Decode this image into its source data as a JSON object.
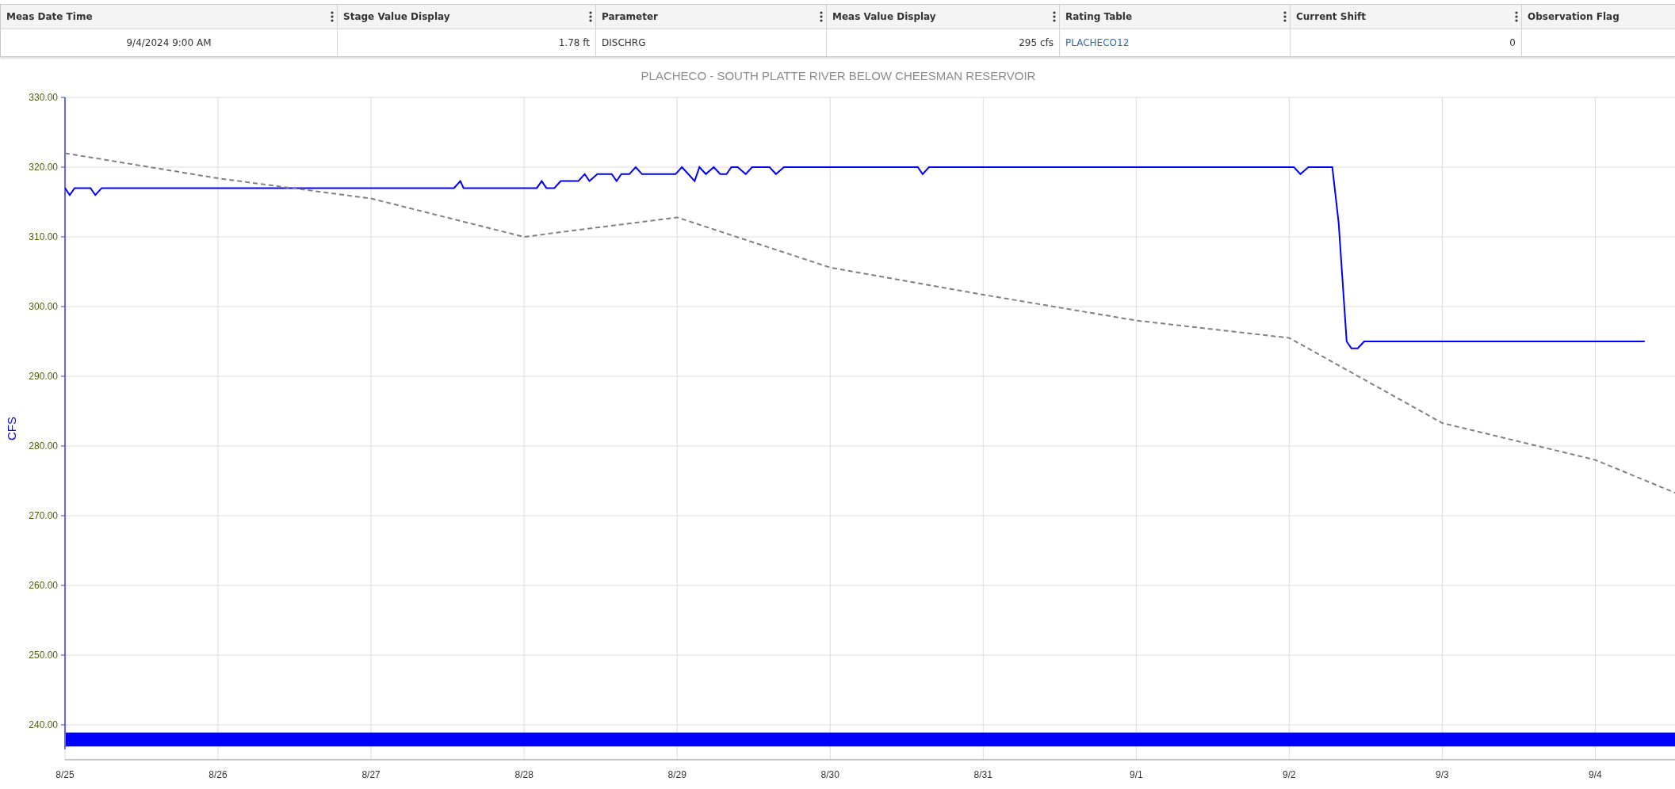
{
  "table": {
    "columns": [
      {
        "label": "Meas Date Time",
        "menu_icon": true
      },
      {
        "label": "Stage Value Display",
        "menu_icon": true
      },
      {
        "label": "Parameter",
        "menu_icon": true
      },
      {
        "label": "Meas Value Display",
        "menu_icon": true
      },
      {
        "label": "Rating Table",
        "menu_icon": true
      },
      {
        "label": "Current Shift",
        "menu_icon": true
      },
      {
        "label": "Observation Flag",
        "menu_icon": false
      }
    ],
    "rows": [
      {
        "cells": [
          {
            "text": "9/4/2024 9:00 AM",
            "kind": "text"
          },
          {
            "text": "1.78 ft",
            "kind": "text"
          },
          {
            "text": "DISCHRG",
            "kind": "text"
          },
          {
            "text": "295 cfs",
            "kind": "text"
          },
          {
            "text": "PLACHECO12",
            "kind": "link"
          },
          {
            "text": "0",
            "kind": "text"
          }
        ]
      }
    ]
  },
  "chart": {
    "chart_data": {
      "type": "line",
      "title": "PLACHECO - SOUTH PLATTE RIVER BELOW CHEESMAN RESERVOIR",
      "ylabel": "CFS",
      "grid": true,
      "xlim": [
        "2024-08-25T00:00",
        "2024-09-04T12:30"
      ],
      "ylim": [
        235,
        330
      ],
      "xticks": [
        {
          "value": "2024-08-25",
          "label": "8/25"
        },
        {
          "value": "2024-08-26",
          "label": "8/26"
        },
        {
          "value": "2024-08-27",
          "label": "8/27"
        },
        {
          "value": "2024-08-28",
          "label": "8/28"
        },
        {
          "value": "2024-08-29",
          "label": "8/29"
        },
        {
          "value": "2024-08-30",
          "label": "8/30"
        },
        {
          "value": "2024-08-31",
          "label": "8/31"
        },
        {
          "value": "2024-09-01",
          "label": "9/1"
        },
        {
          "value": "2024-09-02",
          "label": "9/2"
        },
        {
          "value": "2024-09-03",
          "label": "9/3"
        },
        {
          "value": "2024-09-04",
          "label": "9/4"
        }
      ],
      "yticks": [
        {
          "value": 240,
          "label": "240.00"
        },
        {
          "value": 250,
          "label": "250.00"
        },
        {
          "value": 260,
          "label": "260.00"
        },
        {
          "value": 270,
          "label": "270.00"
        },
        {
          "value": 280,
          "label": "280.00"
        },
        {
          "value": 290,
          "label": "290.00"
        },
        {
          "value": 300,
          "label": "300.00"
        },
        {
          "value": 310,
          "label": "310.00"
        },
        {
          "value": 320,
          "label": "320.00"
        },
        {
          "value": 330,
          "label": "330.00"
        }
      ],
      "series": [
        {
          "color": "#0000ff",
          "line_style": "solid",
          "x": [
            "2024-08-25T00:00",
            "2024-08-25T00:45",
            "2024-08-25T01:30",
            "2024-08-25T04:00",
            "2024-08-25T04:45",
            "2024-08-25T05:45",
            "2024-08-27T13:00",
            "2024-08-27T14:00",
            "2024-08-27T14:30",
            "2024-08-28T02:00",
            "2024-08-28T02:45",
            "2024-08-28T03:30",
            "2024-08-28T04:45",
            "2024-08-28T05:45",
            "2024-08-28T08:30",
            "2024-08-28T09:30",
            "2024-08-28T10:15",
            "2024-08-28T11:30",
            "2024-08-28T13:45",
            "2024-08-28T14:30",
            "2024-08-28T15:15",
            "2024-08-28T16:30",
            "2024-08-28T17:30",
            "2024-08-28T18:30",
            "2024-08-28T23:45",
            "2024-08-29T00:45",
            "2024-08-29T01:45",
            "2024-08-29T02:45",
            "2024-08-29T03:30",
            "2024-08-29T04:30",
            "2024-08-29T05:45",
            "2024-08-29T06:45",
            "2024-08-29T07:45",
            "2024-08-29T08:30",
            "2024-08-29T09:30",
            "2024-08-29T10:45",
            "2024-08-29T11:45",
            "2024-08-29T14:30",
            "2024-08-29T15:30",
            "2024-08-29T16:45",
            "2024-08-30T13:45",
            "2024-08-30T14:30",
            "2024-08-30T15:30",
            "2024-09-02T00:45",
            "2024-09-02T01:45",
            "2024-09-02T03:00",
            "2024-09-02T06:45",
            "2024-09-02T07:45",
            "2024-09-02T09:00",
            "2024-09-02T09:45",
            "2024-09-02T10:45",
            "2024-09-02T11:45",
            "2024-09-04T07:45"
          ],
          "values": [
            317,
            316,
            317,
            317,
            316,
            317,
            317,
            318,
            317,
            317,
            318,
            317,
            317,
            318,
            318,
            319,
            318,
            319,
            319,
            318,
            319,
            319,
            320,
            319,
            319,
            320,
            319,
            318,
            320,
            319,
            320,
            319,
            319,
            320,
            320,
            319,
            320,
            320,
            319,
            320,
            320,
            319,
            320,
            320,
            319,
            320,
            320,
            312,
            295,
            294,
            294,
            295,
            295
          ]
        },
        {
          "color": "#808080",
          "line_style": "dashed",
          "x": [
            "2024-08-25T00:00",
            "2024-08-26T00:00",
            "2024-08-27T00:00",
            "2024-08-28T00:00",
            "2024-08-29T00:00",
            "2024-08-30T00:00",
            "2024-08-31T00:00",
            "2024-09-01T00:00",
            "2024-09-02T00:00",
            "2024-09-03T00:00",
            "2024-09-04T00:00",
            "2024-09-04T12:30"
          ],
          "values": [
            322,
            318.4,
            315.5,
            310,
            312.8,
            305.6,
            301.7,
            298,
            295.5,
            283.3,
            278,
            273.3
          ]
        }
      ],
      "bands": [
        {
          "axis": "y",
          "from": 236.9,
          "to": 238.9,
          "color": "#0000ff"
        }
      ]
    }
  }
}
